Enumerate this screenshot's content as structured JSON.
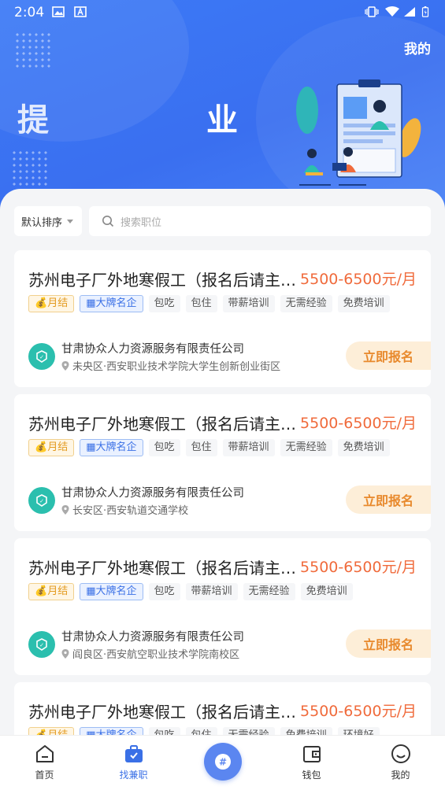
{
  "status_bar": {
    "time": "2:04"
  },
  "header": {
    "mine_link": "我的",
    "banner_text_left": "提",
    "banner_text_right": "业"
  },
  "filter": {
    "sort_label": "默认排序",
    "search_placeholder": "搜索职位"
  },
  "jobs": [
    {
      "title": "苏州电子厂外地寒假工（报名后请主…",
      "salary": "5500-6500元/月",
      "tags": [
        "月结",
        "大牌名企",
        "包吃",
        "包住",
        "带薪培训",
        "无需经验",
        "免费培训"
      ],
      "company": "甘肃协众人力资源服务有限责任公司",
      "address": "未央区·西安职业技术学院大学生创新创业街区",
      "apply_label": "立即报名"
    },
    {
      "title": "苏州电子厂外地寒假工（报名后请主…",
      "salary": "5500-6500元/月",
      "tags": [
        "月结",
        "大牌名企",
        "包吃",
        "包住",
        "带薪培训",
        "无需经验",
        "免费培训"
      ],
      "company": "甘肃协众人力资源服务有限责任公司",
      "address": "长安区·西安轨道交通学校",
      "apply_label": "立即报名"
    },
    {
      "title": "苏州电子厂外地寒假工（报名后请主…",
      "salary": "5500-6500元/月",
      "tags": [
        "月结",
        "大牌名企",
        "包吃",
        "带薪培训",
        "无需经验",
        "免费培训"
      ],
      "company": "甘肃协众人力资源服务有限责任公司",
      "address": "阎良区·西安航空职业技术学院南校区",
      "apply_label": "立即报名"
    },
    {
      "title": "苏州电子厂外地寒假工（报名后请主…",
      "salary": "5500-6500元/月",
      "tags": [
        "月结",
        "大牌名企",
        "包吃",
        "包住",
        "无需经验",
        "免费培训",
        "环境好"
      ]
    }
  ],
  "tabbar": {
    "items": [
      {
        "label": "首页",
        "icon": "home-icon"
      },
      {
        "label": "找兼职",
        "icon": "briefcase-icon",
        "active": true
      },
      {
        "label": "",
        "icon": "hashtag-icon"
      },
      {
        "label": "钱包",
        "icon": "wallet-icon"
      },
      {
        "label": "我的",
        "icon": "smiley-icon"
      }
    ]
  },
  "colors": {
    "primary": "#3a70e6",
    "salary": "#f06b3c",
    "apply_bg": "#fdeed8",
    "apply_text": "#e8892c",
    "hero": "#3c7af6"
  }
}
